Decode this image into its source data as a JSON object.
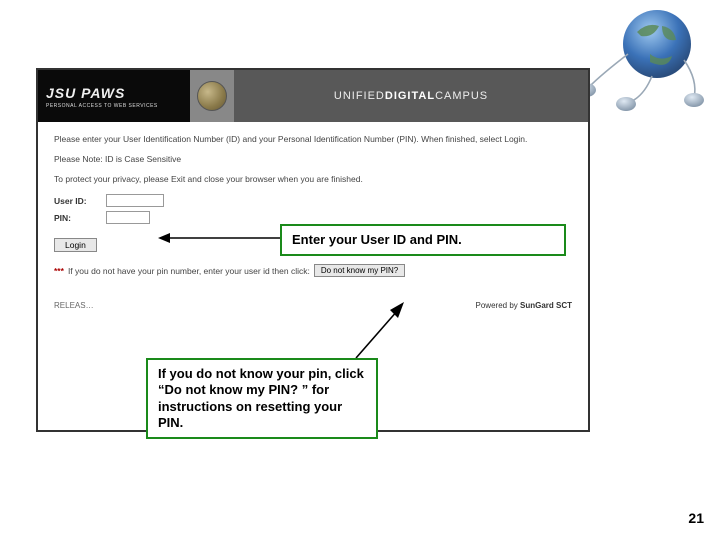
{
  "header": {
    "logo_top": "JSU PAWS",
    "logo_sub": "PERSONAL ACCESS TO WEB SERVICES",
    "banner_thin1": "UNIFIED",
    "banner_bold": "DIGITAL",
    "banner_thin2": "CAMPUS"
  },
  "body": {
    "intro": "Please enter your User Identification Number (ID) and your Personal Identification Number (PIN). When finished, select Login.",
    "note": "Please Note: ID is Case Sensitive",
    "privacy": "To protect your privacy, please Exit and close your browser when you are finished.",
    "userid_label": "User ID:",
    "pin_label": "PIN:",
    "login_label": "Login",
    "stars": "***",
    "hint_text": "If you do not have your pin number, enter your user id then click:",
    "no_pin_label": "Do not know my PIN?",
    "release": "RELEAS…",
    "powered_prefix": "Powered by ",
    "powered_brand": "SunGard SCT"
  },
  "callouts": {
    "c1": "Enter your User ID and PIN.",
    "c2": "If you do not know your pin, click “Do not know my PIN? ” for instructions on resetting your PIN."
  },
  "page_number": "21"
}
